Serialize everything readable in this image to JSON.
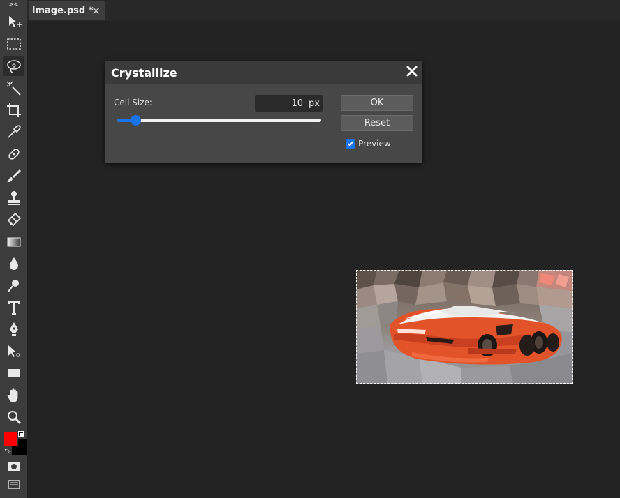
{
  "toolbar": {
    "collapse_label": "> <\n  <",
    "tools": [
      {
        "name": "move-tool-icon"
      },
      {
        "name": "rectangle-select-icon"
      },
      {
        "name": "lasso-select-icon",
        "active": true
      },
      {
        "name": "magic-wand-icon"
      },
      {
        "name": "crop-icon"
      },
      {
        "name": "eyedropper-icon"
      },
      {
        "name": "healing-brush-icon"
      },
      {
        "name": "brush-icon"
      },
      {
        "name": "clone-stamp-icon"
      },
      {
        "name": "eraser-icon"
      },
      {
        "name": "gradient-icon"
      },
      {
        "name": "blur-drop-icon"
      },
      {
        "name": "dodge-icon"
      },
      {
        "name": "type-icon"
      },
      {
        "name": "pen-icon"
      },
      {
        "name": "path-select-icon"
      },
      {
        "name": "shape-rectangle-icon"
      },
      {
        "name": "hand-icon"
      },
      {
        "name": "zoom-icon"
      }
    ],
    "foreground_color": "#ff0000",
    "background_color": "#000000"
  },
  "tabs": [
    {
      "title": "image.psd *",
      "close": "✕"
    }
  ],
  "dialog": {
    "title": "Crystallize",
    "cell_size_label": "Cell Size:",
    "cell_size_value": "10",
    "cell_size_unit": "px",
    "slider_fraction": 0.09,
    "ok_label": "OK",
    "reset_label": "Reset",
    "preview_label": "Preview",
    "preview_checked": true,
    "accent_color": "#1a73e8"
  }
}
